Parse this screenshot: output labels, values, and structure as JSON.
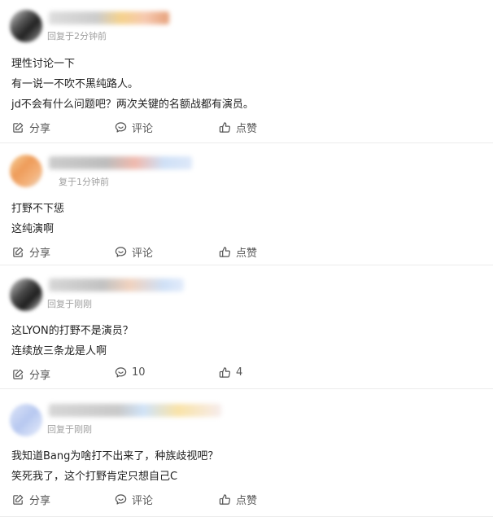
{
  "comments": [
    {
      "time": "回复于2分钟前",
      "lines": [
        "理性讨论一下",
        "有一说一不吹不黑纯路人。",
        "jd不会有什么问题吧？两次关键的名额战都有演员。"
      ],
      "share_label": "分享",
      "comment_label": "评论",
      "like_label": "点赞"
    },
    {
      "time": "复于1分钟前",
      "lines": [
        "打野不下惩",
        "这纯演啊"
      ],
      "share_label": "分享",
      "comment_label": "评论",
      "like_label": "点赞"
    },
    {
      "time": "回复于刚刚",
      "lines": [
        "这LYON的打野不是演员？",
        "连续放三条龙是人啊"
      ],
      "share_label": "分享",
      "comment_label": "10",
      "like_label": "4"
    },
    {
      "time": "回复于刚刚",
      "lines": [
        "我知道Bang为啥打不出来了，种族歧视吧？",
        "笑死我了，这个打野肯定只想自己C"
      ],
      "share_label": "分享",
      "comment_label": "评论",
      "like_label": "点赞"
    }
  ],
  "icons": {
    "share": "share-edit-icon",
    "comment": "comment-bubble-icon",
    "like": "thumbs-up-icon"
  },
  "colors": {
    "text": "#222222",
    "meta": "#a0a0a0",
    "action": "#555555",
    "divider": "#ececec"
  }
}
